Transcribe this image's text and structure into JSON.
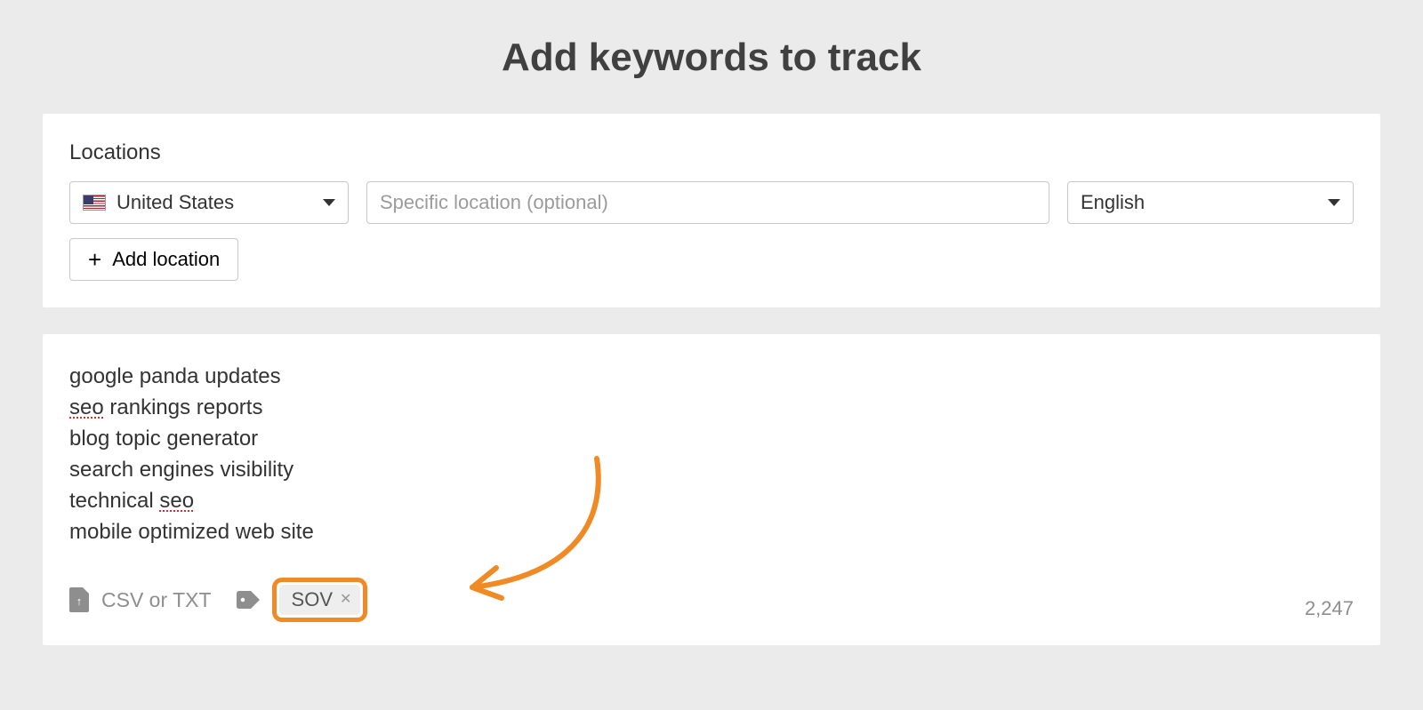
{
  "title": "Add keywords to track",
  "locations": {
    "label": "Locations",
    "country": "United States",
    "specific_placeholder": "Specific location (optional)",
    "language": "English",
    "add_label": "Add location"
  },
  "keywords": {
    "lines": [
      "google panda updates",
      "seo rankings reports",
      "blog topic generator",
      "search engines visibility",
      "technical seo",
      "mobile optimized web site"
    ],
    "misspelled": [
      "seo"
    ]
  },
  "footer": {
    "upload_label": "CSV or TXT",
    "tag": "SOV",
    "char_count": "2,247"
  }
}
